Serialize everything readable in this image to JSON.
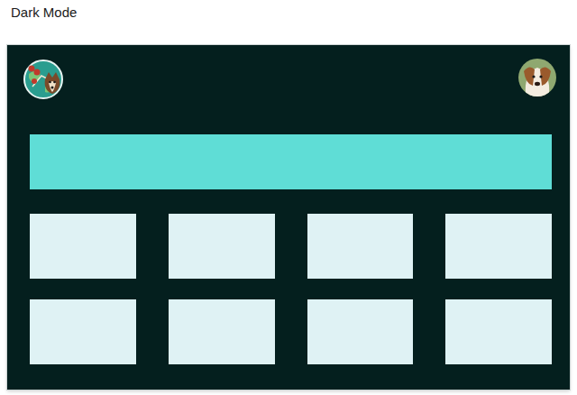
{
  "title": "Dark Mode"
}
